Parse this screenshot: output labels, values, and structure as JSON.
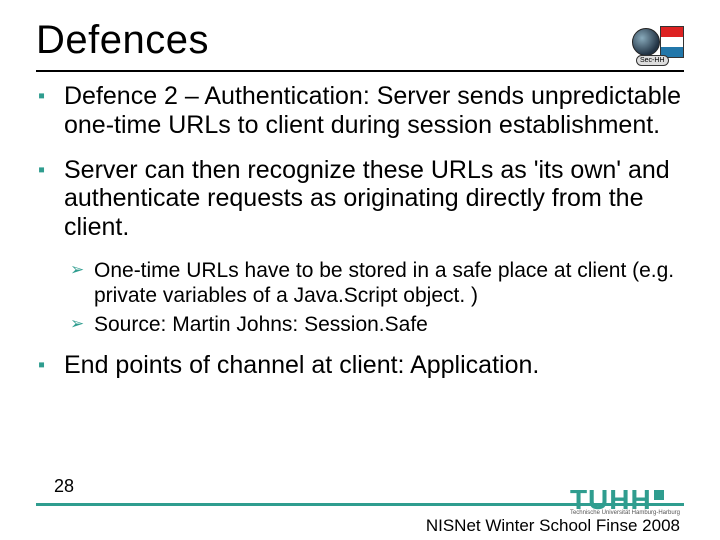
{
  "title": "Defences",
  "logo_label": "Sec-HH",
  "bullets": [
    {
      "text": "Defence 2 – Authentication: Server sends unpredictable one-time URLs to client during session establishment."
    },
    {
      "text": "Server can then recognize these URLs as 'its own' and authenticate requests as originating directly from the client.",
      "sub": [
        "One-time URLs have to be stored in a safe place at client (e.g. private variables of a Java.Script object. )",
        "Source: Martin Johns: Session.Safe"
      ]
    },
    {
      "text": "End points of channel at client: Application."
    }
  ],
  "slide_number": "28",
  "org_logo": "TUHH",
  "org_sub": "Technische Universität Hamburg-Harburg",
  "footer": "NISNet Winter School Finse 2008"
}
